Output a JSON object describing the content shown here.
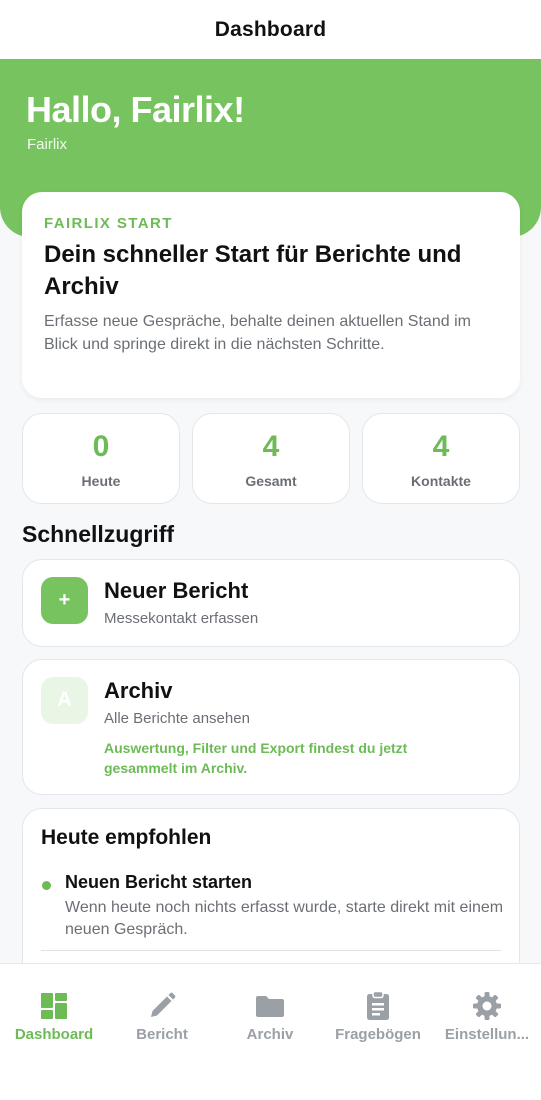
{
  "nav": {
    "title": "Dashboard"
  },
  "hero": {
    "greeting": "Hallo, Fairlix!",
    "subtitle": "Fairlix"
  },
  "start_card": {
    "eyebrow": "FAIRLIX START",
    "title": "Dein schneller Start für Berichte und Archiv",
    "description": "Erfasse neue Gespräche, behalte deinen aktuellen Stand im Blick und springe direkt in die nächsten Schritte."
  },
  "stats": [
    {
      "value": "0",
      "label": "Heute"
    },
    {
      "value": "4",
      "label": "Gesamt"
    },
    {
      "value": "4",
      "label": "Kontakte"
    }
  ],
  "quick_access": {
    "title": "Schnellzugriff",
    "new_report": {
      "icon_text": "+",
      "title": "Neuer Bericht",
      "subtitle": "Messekontakt erfassen"
    },
    "archive": {
      "icon_text": "A",
      "title": "Archiv",
      "subtitle": "Alle Berichte ansehen",
      "note": "Auswertung, Filter und Export findest du jetzt gesammelt im Archiv."
    }
  },
  "recommendations": {
    "title": "Heute empfohlen",
    "items": [
      {
        "title": "Neuen Bericht starten",
        "description": "Wenn heute noch nichts erfasst wurde, starte direkt mit einem neuen Gespräch."
      }
    ]
  },
  "tabs": [
    {
      "label": "Dashboard",
      "icon": "dashboard-icon",
      "active": true
    },
    {
      "label": "Bericht",
      "icon": "pencil-icon",
      "active": false
    },
    {
      "label": "Archiv",
      "icon": "folder-icon",
      "active": false
    },
    {
      "label": "Fragebögen",
      "icon": "clipboard-icon",
      "active": false
    },
    {
      "label": "Einstellun...",
      "icon": "gear-icon",
      "active": false
    }
  ],
  "colors": {
    "accent": "#77c35f",
    "accent_text": "#6dbb56",
    "inactive": "#9aa0a6"
  }
}
